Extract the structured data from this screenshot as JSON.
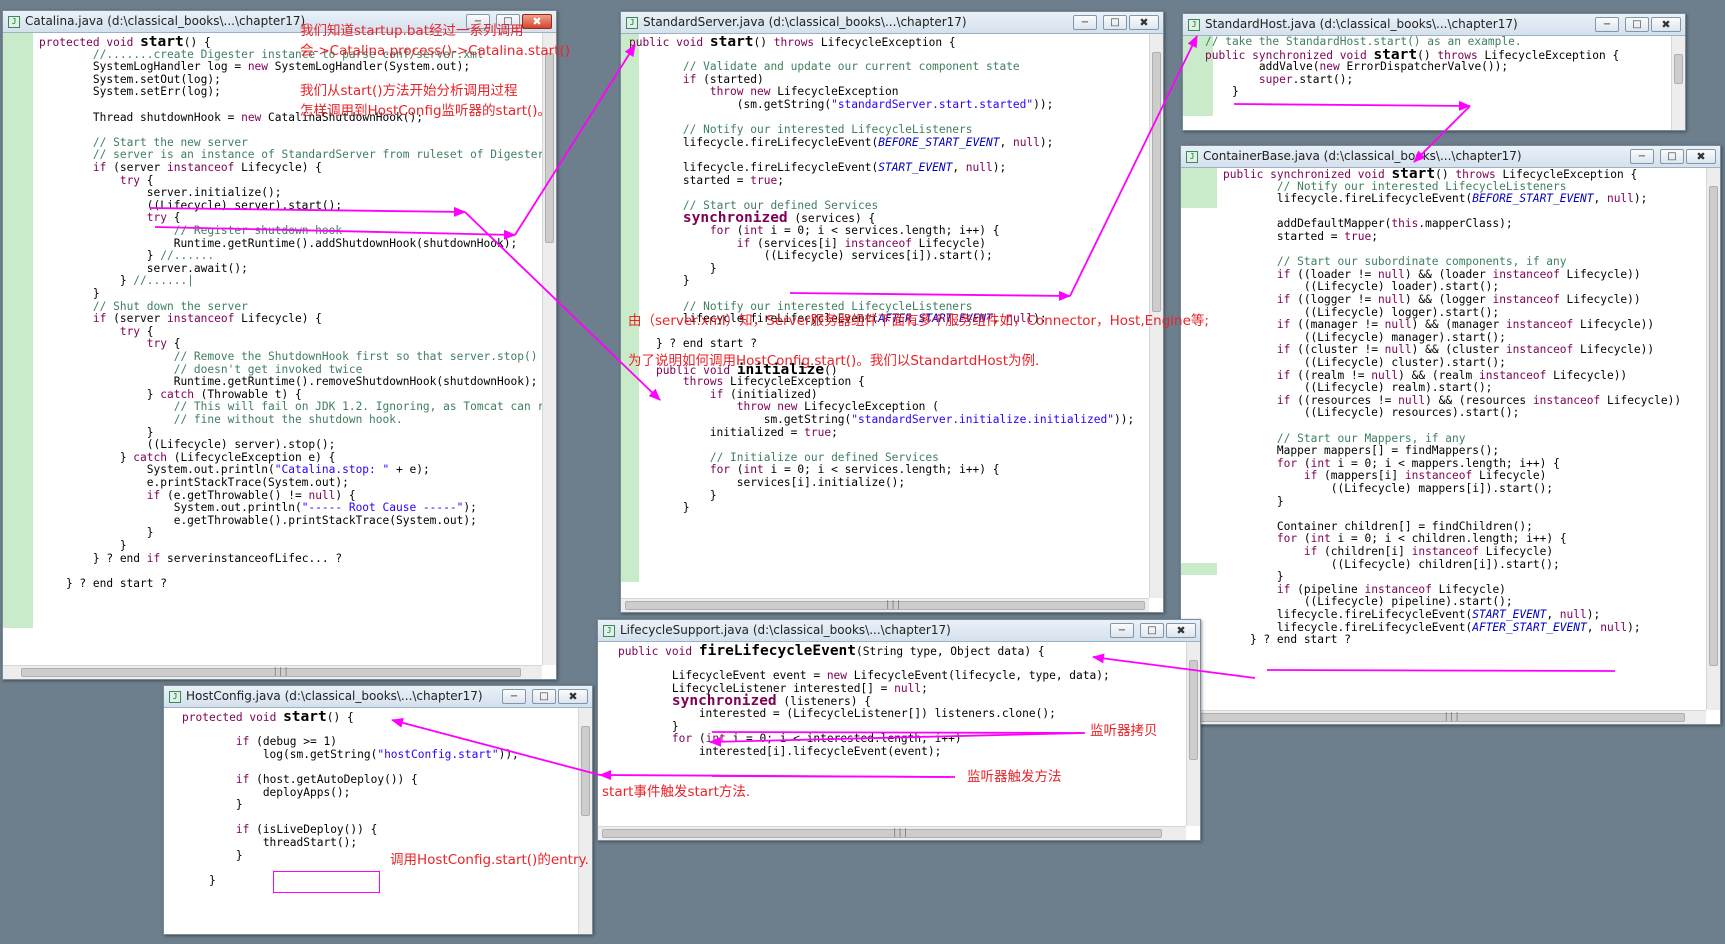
{
  "windows": {
    "catalina": {
      "title": "Catalina.java (d:\\classical_books\\...\\chapter17)"
    },
    "standardServer": {
      "title": "StandardServer.java (d:\\classical_books\\...\\chapter17)"
    },
    "standardHost": {
      "title": "StandardHost.java (d:\\classical_books\\...\\chapter17)"
    },
    "containerBase": {
      "title": "ContainerBase.java (d:\\classical_books\\...\\chapter17)"
    },
    "lifecycleSupport": {
      "title": "LifecycleSupport.java (d:\\classical_books\\...\\chapter17)"
    },
    "hostConfig": {
      "title": "HostConfig.java (d:\\classical_books\\...\\chapter17)"
    }
  },
  "window_buttons": {
    "minimize": "−",
    "restore": "□",
    "close": "✖"
  },
  "code": {
    "catalina": [
      "protected void start() {",
      "        //.......create Digester instance to parse conf/server.xml",
      "        SystemLogHandler log = new SystemLogHandler(System.out);",
      "        System.setOut(log);",
      "        System.setErr(log);",
      "",
      "        Thread shutdownHook = new CatalinaShutdownHook();",
      "",
      "        // Start the new server",
      "        // server is an instance of StandardServer from ruleset of Digester",
      "        if (server instanceof Lifecycle) {",
      "            try {",
      "                server.initialize();",
      "                ((Lifecycle) server).start();",
      "                try {",
      "                    // Register shutdown hook",
      "                    Runtime.getRuntime().addShutdownHook(shutdownHook);",
      "                } //......",
      "                server.await();",
      "            } //......|",
      "        }",
      "        // Shut down the server",
      "        if (server instanceof Lifecycle) {",
      "            try {",
      "                try {",
      "                    // Remove the ShutdownHook first so that server.stop()",
      "                    // doesn't get invoked twice",
      "                    Runtime.getRuntime().removeShutdownHook(shutdownHook);",
      "                } catch (Throwable t) {",
      "                    // This will fail on JDK 1.2. Ignoring, as Tomcat can run",
      "                    // fine without the shutdown hook.",
      "                }",
      "                ((Lifecycle) server).stop();",
      "            } catch (LifecycleException e) {",
      "                System.out.println(\"Catalina.stop: \" + e);",
      "                e.printStackTrace(System.out);",
      "                if (e.getThrowable() != null) {",
      "                    System.out.println(\"----- Root Cause -----\");",
      "                    e.getThrowable().printStackTrace(System.out);",
      "                }",
      "            }",
      "        } ? end if serverinstanceofLifec... ?",
      "",
      "    } ? end start ?"
    ],
    "standardServer": [
      "public void start() throws LifecycleException {",
      "",
      "        // Validate and update our current component state",
      "        if (started)",
      "            throw new LifecycleException",
      "                (sm.getString(\"standardServer.start.started\"));",
      "",
      "        // Notify our interested LifecycleListeners",
      "        lifecycle.fireLifecycleEvent(BEFORE_START_EVENT, null);",
      "",
      "        lifecycle.fireLifecycleEvent(START_EVENT, null);",
      "        started = true;",
      "",
      "        // Start our defined Services",
      "        synchronized (services) {",
      "            for (int i = 0; i < services.length; i++) {",
      "                if (services[i] instanceof Lifecycle)",
      "                    ((Lifecycle) services[i]).start();",
      "            }",
      "        }",
      "",
      "        // Notify our interested LifecycleListeners",
      "        lifecycle.fireLifecycleEvent(AFTER_START_EVENT, null);",
      "",
      "    } ? end start ?",
      "",
      "    public void initialize()",
      "        throws LifecycleException {",
      "            if (initialized)",
      "                throw new LifecycleException (",
      "                    sm.getString(\"standardServer.initialize.initialized\"));",
      "            initialized = true;",
      "",
      "            // Initialize our defined Services",
      "            for (int i = 0; i < services.length; i++) {",
      "                services[i].initialize();",
      "            }",
      "        }"
    ],
    "standardHost": [
      "// take the StandardHost.start() as an example.",
      "public synchronized void start() throws LifecycleException {",
      "        addValve(new ErrorDispatcherValve());",
      "        super.start();",
      "    }"
    ],
    "containerBase": [
      "public synchronized void start() throws LifecycleException {",
      "        // Notify our interested LifecycleListeners",
      "        lifecycle.fireLifecycleEvent(BEFORE_START_EVENT, null);",
      "",
      "        addDefaultMapper(this.mapperClass);",
      "        started = true;",
      "",
      "        // Start our subordinate components, if any",
      "        if ((loader != null) && (loader instanceof Lifecycle))",
      "            ((Lifecycle) loader).start();",
      "        if ((logger != null) && (logger instanceof Lifecycle))",
      "            ((Lifecycle) logger).start();",
      "        if ((manager != null) && (manager instanceof Lifecycle))",
      "            ((Lifecycle) manager).start();",
      "        if ((cluster != null) && (cluster instanceof Lifecycle))",
      "            ((Lifecycle) cluster).start();",
      "        if ((realm != null) && (realm instanceof Lifecycle))",
      "            ((Lifecycle) realm).start();",
      "        if ((resources != null) && (resources instanceof Lifecycle))",
      "            ((Lifecycle) resources).start();",
      "",
      "        // Start our Mappers, if any",
      "        Mapper mappers[] = findMappers();",
      "        for (int i = 0; i < mappers.length; i++) {",
      "            if (mappers[i] instanceof Lifecycle)",
      "                ((Lifecycle) mappers[i]).start();",
      "        }",
      "",
      "        Container children[] = findChildren();",
      "        for (int i = 0; i < children.length; i++) {",
      "            if (children[i] instanceof Lifecycle)",
      "                ((Lifecycle) children[i]).start();",
      "        }",
      "        if (pipeline instanceof Lifecycle)",
      "            ((Lifecycle) pipeline).start();",
      "        lifecycle.fireLifecycleEvent(START_EVENT, null);",
      "        lifecycle.fireLifecycleEvent(AFTER_START_EVENT, null);",
      "    } ? end start ?"
    ],
    "lifecycleSupport": [
      "public void fireLifecycleEvent(String type, Object data) {",
      "",
      "        LifecycleEvent event = new LifecycleEvent(lifecycle, type, data);",
      "        LifecycleListener interested[] = null;",
      "        synchronized (listeners) {",
      "            interested = (LifecycleListener[]) listeners.clone();",
      "        }",
      "        for (int i = 0; i < interested.length; i++)",
      "            interested[i].lifecycleEvent(event);"
    ],
    "hostConfig": [
      "protected void start() {",
      "",
      "        if (debug >= 1)",
      "            log(sm.getString(\"hostConfig.start\"));",
      "",
      "        if (host.getAutoDeploy()) {",
      "            deployApps();",
      "        }",
      "",
      "        if (isLiveDeploy()) {",
      "            threadStart();",
      "        }",
      "",
      "    }"
    ]
  },
  "annotations": {
    "a1": "我们知道startup.bat经过一系列调用",
    "a2": "会->Catalina.process()->Catalina.start()",
    "a3": "我们从start()方法开始分析调用过程",
    "a4": "怎样调用到HostConfig监听器的start()。",
    "a5": "由（server.xml）知，Server服务器组件下面有多个服务组件如，Connector，Host,Engine等;",
    "a6": "为了说明如何调用HostConfig.start()。我们以StandartdHost为例.",
    "a7": "监听器拷贝",
    "a8": "监听器触发方法",
    "a9": "start事件触发start方法.",
    "a10": "调用HostConfig.start()的entry."
  },
  "colors": {
    "annotation": "#e8242a",
    "arrow": "#ff00ff",
    "keyword": "#7f0055",
    "comment": "#3f7f5f",
    "string": "#2a00ff",
    "field": "#0000c0"
  }
}
